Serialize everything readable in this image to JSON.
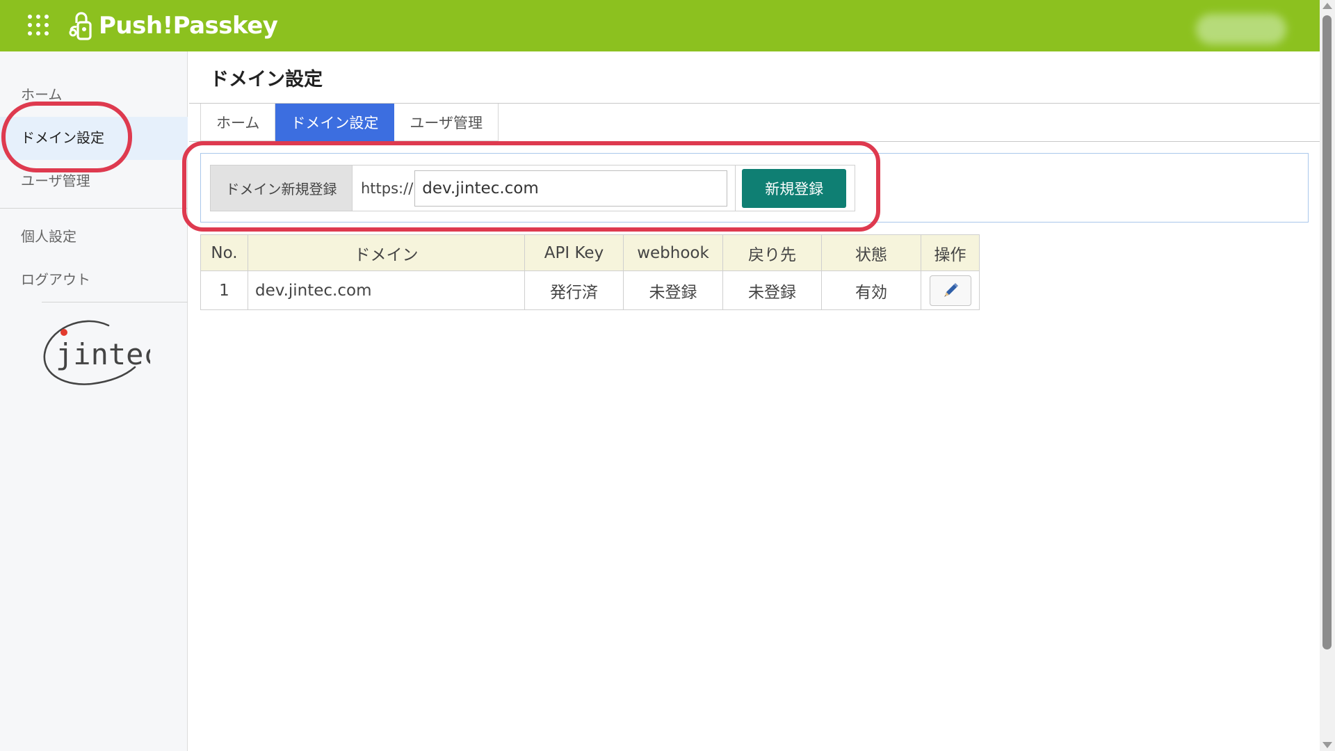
{
  "header": {
    "app_name": "Push!Passkey",
    "icons": {
      "apps": "grid-dots-icon",
      "logo": "lock-phone-logo-icon",
      "user": "blurred-user-avatar"
    }
  },
  "sidebar": {
    "items": [
      {
        "label": "ホーム",
        "active": false
      },
      {
        "label": "ドメイン設定",
        "active": true
      },
      {
        "label": "ユーザ管理",
        "active": false
      },
      {
        "label": "個人設定",
        "active": false
      },
      {
        "label": "ログアウト",
        "active": false
      }
    ],
    "logo_text": "jintec"
  },
  "main": {
    "page_title": "ドメイン設定",
    "tabs": [
      {
        "label": "ホーム",
        "active": false
      },
      {
        "label": "ドメイン設定",
        "active": true
      },
      {
        "label": "ユーザ管理",
        "active": false
      }
    ],
    "register": {
      "label": "ドメイン新規登録",
      "prefix": "https://",
      "value": "dev.jintec.com",
      "button": "新規登録"
    },
    "table": {
      "headers": [
        "No.",
        "ドメイン",
        "API Key",
        "webhook",
        "戻り先",
        "状態",
        "操作"
      ],
      "rows": [
        {
          "no": "1",
          "domain": "dev.jintec.com",
          "api_key": "発行済",
          "webhook": "未登録",
          "return_to": "未登録",
          "status": "有効",
          "action_icon": "pencil-icon"
        }
      ]
    }
  },
  "colors": {
    "header_bg": "#8cc11f",
    "active_tab": "#3c6ee0",
    "register_button": "#0f7f73",
    "table_header_bg": "#f6f4dc",
    "highlight_ring": "#de3a4f"
  }
}
